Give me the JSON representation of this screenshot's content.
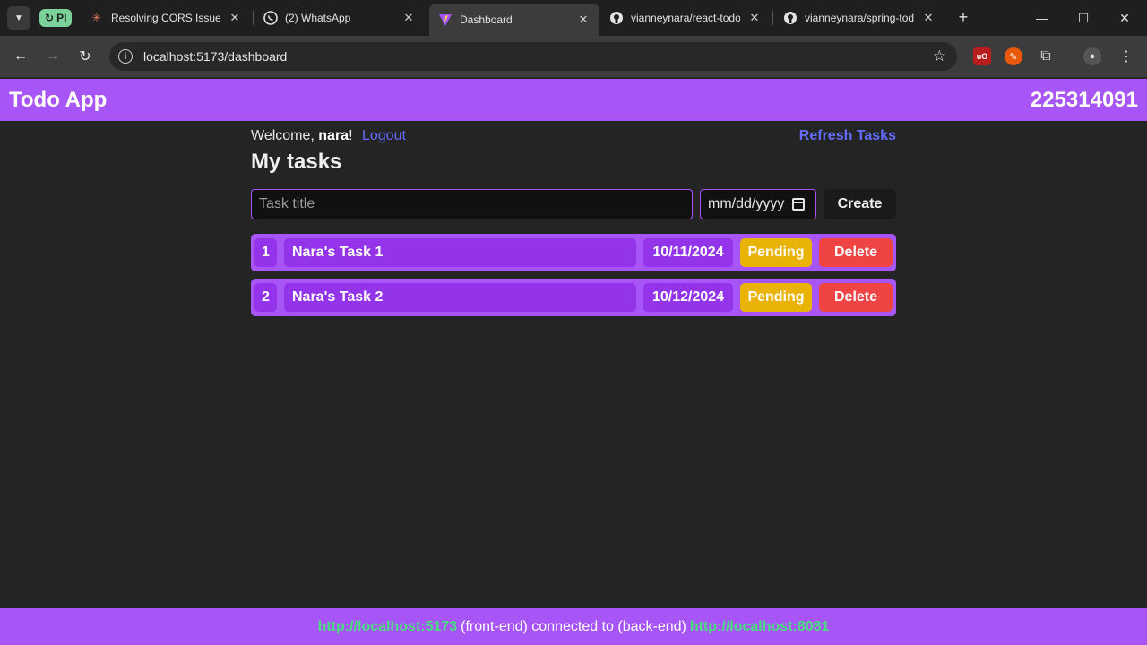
{
  "browser": {
    "tab_group_label": "PI",
    "tabs": [
      {
        "title": "Resolving CORS Issues",
        "icon": "asterisk-icon"
      },
      {
        "title": "(2) WhatsApp",
        "icon": "whatsapp-icon"
      },
      {
        "title": "Dashboard",
        "icon": "vite-icon",
        "active": true
      },
      {
        "title": "vianneynara/react-todo",
        "icon": "github-icon"
      },
      {
        "title": "vianneynara/spring-todo",
        "icon": "github-icon"
      }
    ],
    "url": "localhost:5173/dashboard"
  },
  "header": {
    "app_title": "Todo App",
    "user_id": "225314091"
  },
  "main": {
    "welcome_prefix": "Welcome, ",
    "username": "nara",
    "welcome_suffix": "!",
    "logout_label": "Logout",
    "refresh_label": "Refresh Tasks",
    "heading": "My tasks",
    "form": {
      "title_placeholder": "Task title",
      "date_placeholder": "mm/dd/yyyy",
      "create_label": "Create"
    },
    "tasks": [
      {
        "id": "1",
        "title": "Nara's Task 1",
        "date": "10/11/2024",
        "status": "Pending",
        "delete_label": "Delete"
      },
      {
        "id": "2",
        "title": "Nara's Task 2",
        "date": "10/12/2024",
        "status": "Pending",
        "delete_label": "Delete"
      }
    ]
  },
  "footer": {
    "frontend_url": "http://localhost:5173",
    "middle_text": "(front-end) connected to (back-end)",
    "backend_url": "http://localhost:8081"
  },
  "colors": {
    "accent": "#a855f7",
    "cell": "#9333ea",
    "pending": "#eab308",
    "delete": "#ef4444",
    "link": "#646cff",
    "host": "#4ade80"
  }
}
